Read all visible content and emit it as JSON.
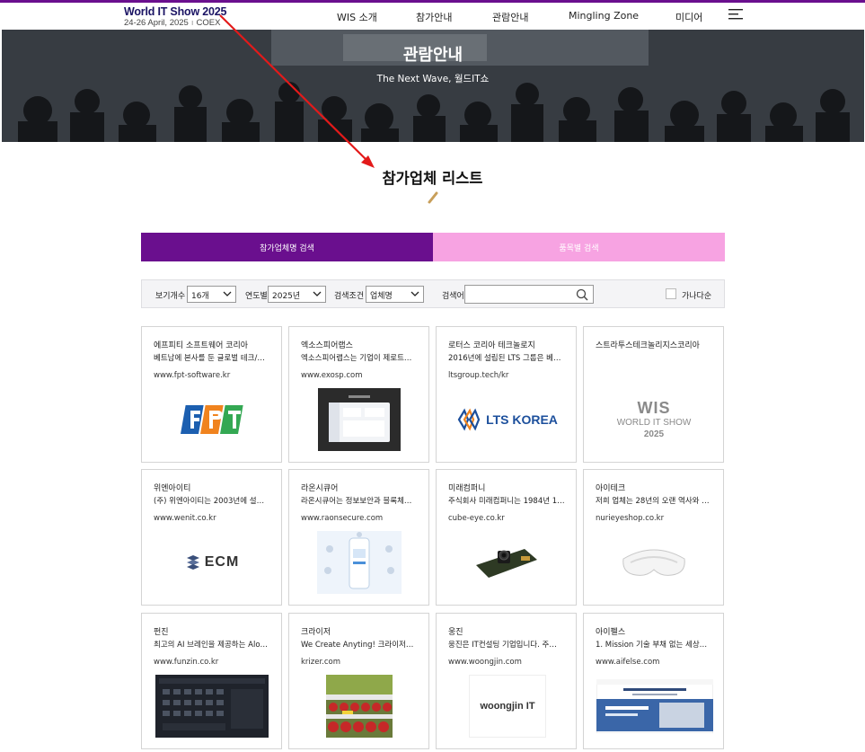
{
  "header": {
    "logo_title": "World IT Show 2025",
    "logo_date": "24-26 April, 2025",
    "logo_venue": "COEX",
    "nav": [
      "WIS 소개",
      "참가안내",
      "관람안내",
      "Mingling Zone",
      "미디어"
    ]
  },
  "hero": {
    "title": "관람안내",
    "subtitle": "The Next Wave, 월드IT쇼"
  },
  "section": {
    "title": "참가업체 리스트"
  },
  "tabs": {
    "company": "참가업체명 검색",
    "category": "품목별 검색"
  },
  "filter": {
    "count_label": "보기개수",
    "count_value": "16개",
    "year_label": "연도별",
    "year_value": "2025년",
    "condition_label": "검색조건",
    "condition_value": "업체명",
    "keyword_label": "검색어",
    "keyword_value": "",
    "sort_label": "가나다순"
  },
  "companies": [
    {
      "name": "에프피티 소프트웨어 코리아",
      "desc": "베트남에 본사를 둔 글로벌 테크/…",
      "url": "www.fpt-software.kr"
    },
    {
      "name": "엑소스피어랩스",
      "desc": "엑소스피어랩스는 기업이 제로트…",
      "url": "www.exosp.com"
    },
    {
      "name": "로터스 코리아 테크놀로지",
      "desc": "2016년에 설립된 LTS 그룹은 베…",
      "url": "ltsgroup.tech/kr",
      "logo_text": "LTS KOREA"
    },
    {
      "name": "스트라투스테크놀리지스코리아",
      "desc": "",
      "url": "",
      "logo_text": [
        "WIS",
        "WORLD IT SHOW",
        "2025"
      ]
    },
    {
      "name": "위엔아이티",
      "desc": "(주) 위엔아이티는 2003년에 설…",
      "url": "www.wenit.co.kr",
      "logo_text": "ECM"
    },
    {
      "name": "라온시큐어",
      "desc": "라온시큐어는 정보보안과 블록체…",
      "url": "www.raonsecure.com"
    },
    {
      "name": "미래컴퍼니",
      "desc": "주식회사 미래컴퍼니는 1984년 11…",
      "url": "cube-eye.co.kr"
    },
    {
      "name": "아이테크",
      "desc": "저희 업체는 28년의 오랜 역사와 …",
      "url": "nurieyeshop.co.kr"
    },
    {
      "name": "펀진",
      "desc": "최고의 AI 브레인을 제공하는 Alo…",
      "url": "www.funzin.co.kr"
    },
    {
      "name": "크라이저",
      "desc": "We Create Anyting! 크라이저는…",
      "url": "krizer.com"
    },
    {
      "name": "웅진",
      "desc": "웅진은 IT컨설팅 기업입니다. 주…",
      "url": "www.woongjin.com",
      "logo_text": "woongjin IT"
    },
    {
      "name": "아이펠스",
      "desc": "1. Mission 기술 부채 없는 세상…",
      "url": "www.aifelse.com"
    }
  ],
  "colors": {
    "brand_purple": "#6a0f8e",
    "tab_pink": "#f7a3e2",
    "annotation_arrow": "#e31a1a"
  }
}
